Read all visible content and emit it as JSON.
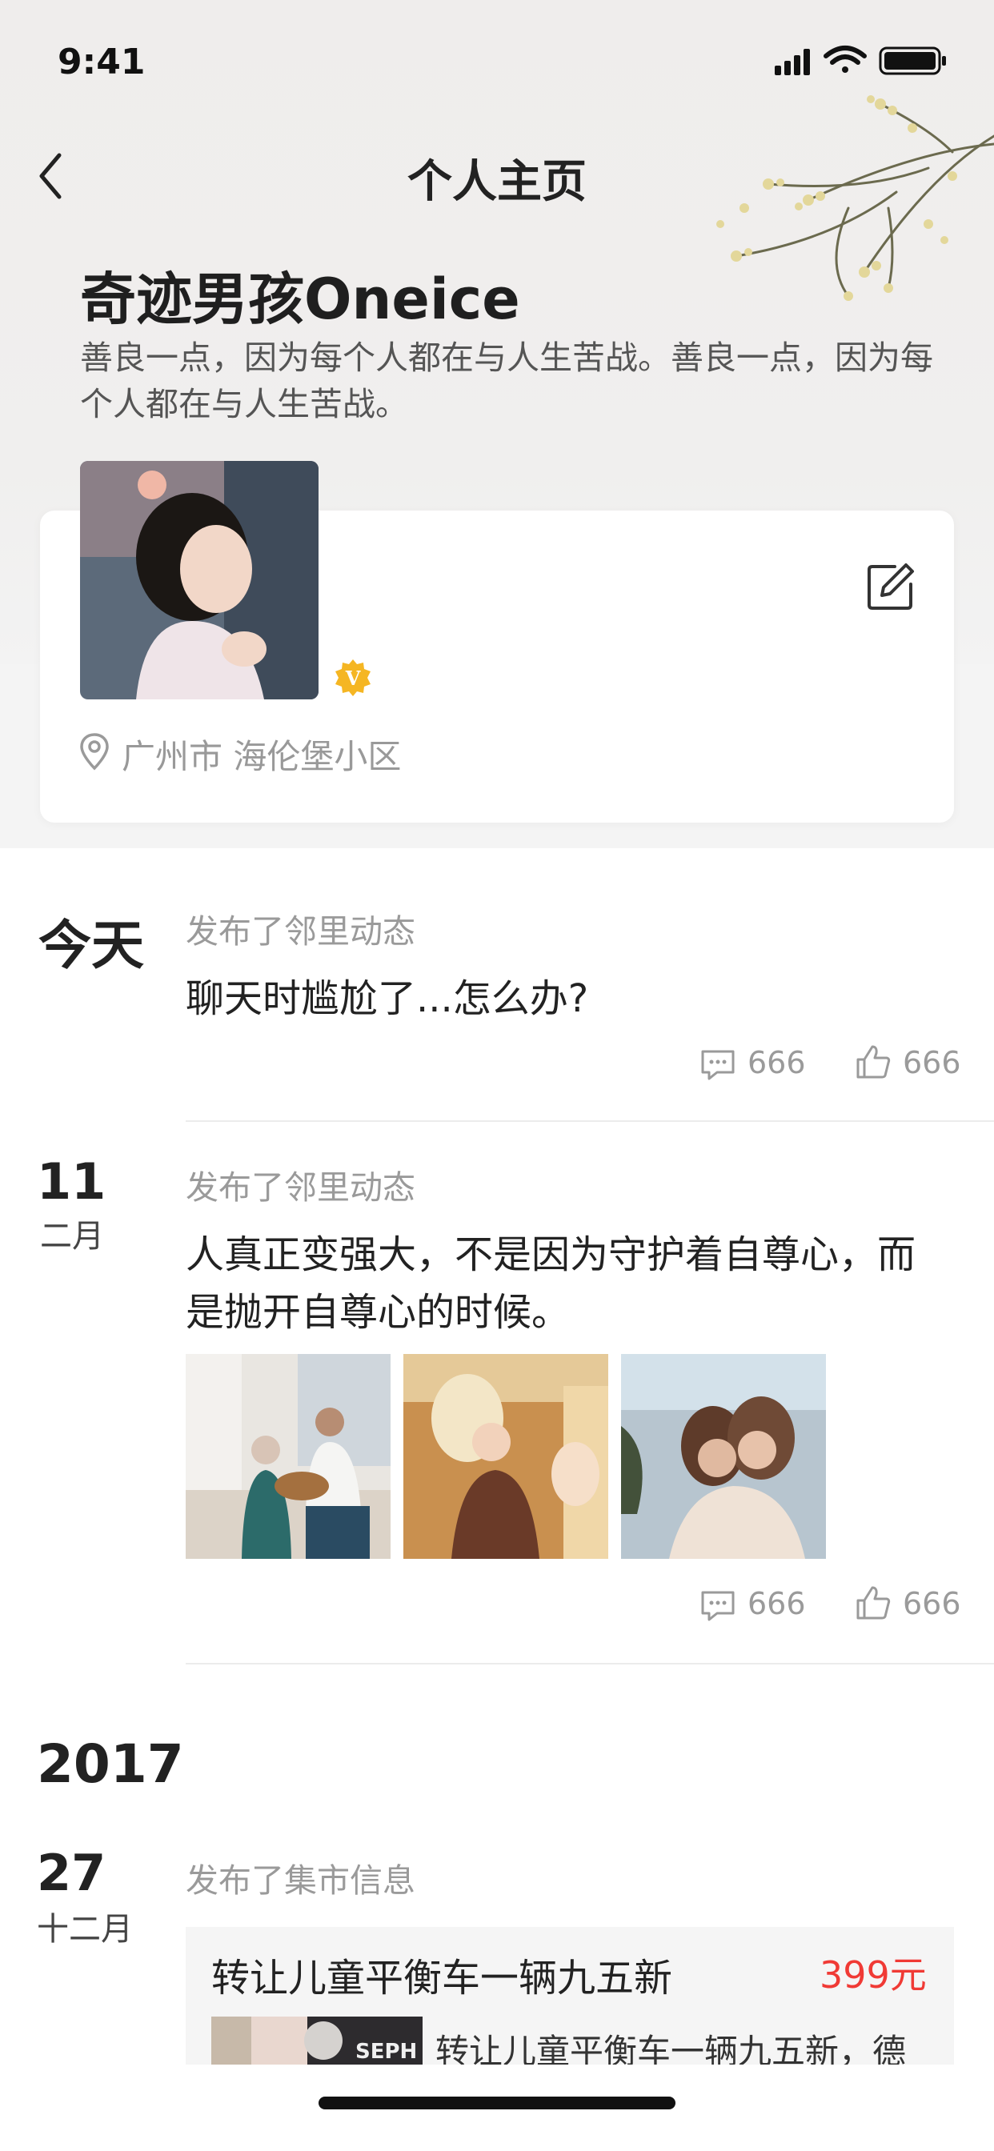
{
  "status_bar": {
    "time": "9:41"
  },
  "nav": {
    "title": "个人主页"
  },
  "profile": {
    "name": "奇迹男孩Oneice",
    "bio": "善良一点，因为每个人都在与人生苦战。善良一点，因为每个人都在与人生苦战。",
    "badge": "V",
    "location": "广州市 海伦堡小区"
  },
  "feed": [
    {
      "date_label": "今天",
      "meta": "发布了邻里动态",
      "content": "聊天时尴尬了...怎么办?",
      "comments": "666",
      "likes": "666"
    },
    {
      "day": "11",
      "month": "二月",
      "meta": "发布了邻里动态",
      "content_line1": "人真正变强大，不是因为守护着自尊心，而",
      "content_line2": "是抛开自尊心的时候。",
      "comments": "666",
      "likes": "666"
    }
  ],
  "year_section": {
    "year": "2017",
    "day": "27",
    "month": "十二月",
    "meta": "发布了集市信息",
    "market": {
      "title": "转让儿童平衡车一辆九五新",
      "price": "399元",
      "desc": "转让儿童平衡车一辆九五新，德",
      "thumb_text": "SEPH"
    }
  },
  "colors": {
    "price": "#f03a35",
    "badge": "#f5b623",
    "meta": "#9a9a9a"
  }
}
